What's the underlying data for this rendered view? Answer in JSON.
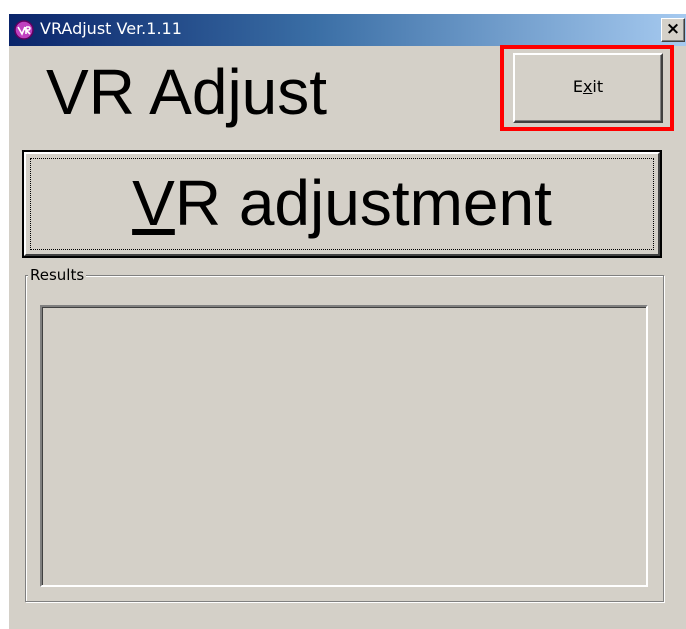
{
  "window": {
    "title": "VRAdjust Ver.1.11",
    "close_glyph": "×",
    "icon": "app-icon"
  },
  "main": {
    "heading": "VR Adjust",
    "exit_button": {
      "mnemonic_before": "E",
      "mnemonic_char": "x",
      "mnemonic_after": "it"
    },
    "adjust_button": {
      "mnemonic_before": "",
      "mnemonic_char": "V",
      "mnemonic_after": "R adjustment"
    },
    "results": {
      "label": "Results",
      "content": ""
    }
  },
  "colors": {
    "highlight": "#ff0000",
    "face": "#d4d0c8",
    "titlebar_start": "#0a246a",
    "titlebar_end": "#a6caf0"
  }
}
